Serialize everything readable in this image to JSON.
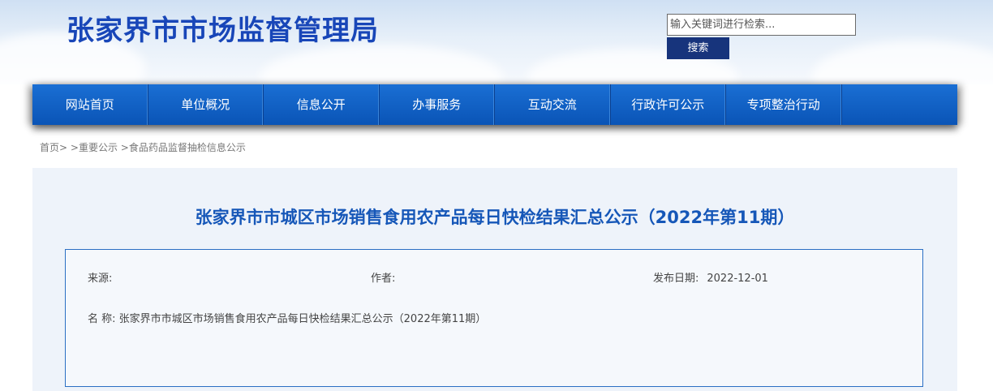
{
  "header": {
    "site_title": "张家界市市场监督管理局",
    "search": {
      "placeholder": "输入关键词进行检索...",
      "button_label": "搜索"
    }
  },
  "nav": {
    "items": [
      {
        "label": "网站首页"
      },
      {
        "label": "单位概况"
      },
      {
        "label": "信息公开"
      },
      {
        "label": "办事服务"
      },
      {
        "label": "互动交流"
      },
      {
        "label": "行政许可公示"
      },
      {
        "label": "专项整治行动"
      }
    ]
  },
  "breadcrumb": {
    "home": "首页>",
    "level1": ">重要公示",
    "level2": ">食品药品监督抽检信息公示"
  },
  "article": {
    "title": "张家界市市城区市场销售食用农产品每日快检结果汇总公示（2022年第11期）",
    "source_label": "来源:",
    "author_label": "作者:",
    "date_label": "发布日期:",
    "date_value": "2022-12-01",
    "name_label": "名 称:",
    "name_value": "张家界市市城区市场销售食用农产品每日快检结果汇总公示（2022年第11期）"
  },
  "colors": {
    "title_blue": "#1846b8",
    "nav_blue": "#0a54b6",
    "search_button": "#17347c",
    "box_border": "#2b6fc4",
    "article_title": "#1657b8"
  }
}
